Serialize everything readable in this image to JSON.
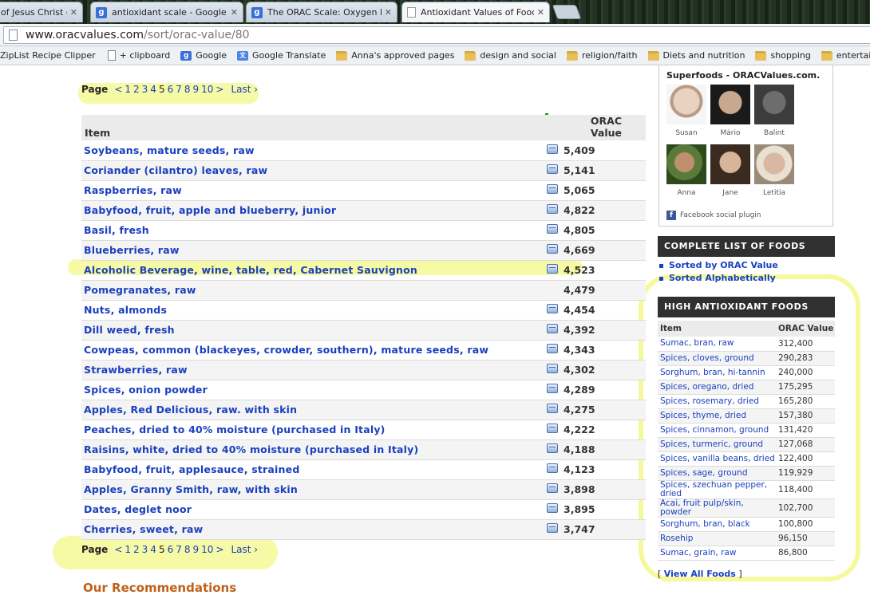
{
  "tabs": [
    {
      "label": "of Jesus Christ o",
      "icon": "page-icon"
    },
    {
      "label": "antioxidant scale - Google S",
      "icon": "google-icon"
    },
    {
      "label": "The ORAC Scale: Oxygen R",
      "icon": "google-icon"
    },
    {
      "label": "Antioxidant Values of Foods",
      "icon": "page-icon"
    }
  ],
  "tab_close": "✕",
  "address": {
    "host": "www.oracvalues.com",
    "path": "/sort/orac-value/80"
  },
  "bookmarks": [
    {
      "label": "ZipList Recipe Clipper",
      "icon": "none"
    },
    {
      "label": "+ clipboard",
      "icon": "page-icon"
    },
    {
      "label": "Google",
      "icon": "google-icon"
    },
    {
      "label": "Google Translate",
      "icon": "translate-icon"
    },
    {
      "label": "Anna's approved pages",
      "icon": "folder-icon"
    },
    {
      "label": "design and social",
      "icon": "folder-icon"
    },
    {
      "label": "religion/faith",
      "icon": "folder-icon"
    },
    {
      "label": "Diets and nutrition",
      "icon": "folder-icon"
    },
    {
      "label": "shopping",
      "icon": "folder-icon"
    },
    {
      "label": "entertainment",
      "icon": "folder-icon"
    }
  ],
  "pager": {
    "label": "Page",
    "prev": "<",
    "pages": [
      "1",
      "2",
      "3",
      "4",
      "5",
      "6",
      "7",
      "8",
      "9",
      "10"
    ],
    "current": "5",
    "next": ">",
    "last": "Last ›"
  },
  "table": {
    "col_item": "Item",
    "col_value": "ORAC Value",
    "rows": [
      {
        "name": "Soybeans, mature seeds, raw",
        "value": "5,409",
        "icon": true
      },
      {
        "name": "Coriander (cilantro) leaves, raw",
        "value": "5,141",
        "icon": true
      },
      {
        "name": "Raspberries, raw",
        "value": "5,065",
        "icon": true
      },
      {
        "name": "Babyfood, fruit, apple and blueberry, junior",
        "value": "4,822",
        "icon": true
      },
      {
        "name": "Basil, fresh",
        "value": "4,805",
        "icon": true
      },
      {
        "name": "Blueberries, raw",
        "value": "4,669",
        "icon": true
      },
      {
        "name": "Alcoholic Beverage, wine, table, red, Cabernet Sauvignon",
        "value": "4,523",
        "icon": true
      },
      {
        "name": "Pomegranates, raw",
        "value": "4,479",
        "icon": false
      },
      {
        "name": "Nuts, almonds",
        "value": "4,454",
        "icon": true
      },
      {
        "name": "Dill weed, fresh",
        "value": "4,392",
        "icon": true
      },
      {
        "name": "Cowpeas, common (blackeyes, crowder, southern), mature seeds, raw",
        "value": "4,343",
        "icon": true
      },
      {
        "name": "Strawberries, raw",
        "value": "4,302",
        "icon": true
      },
      {
        "name": "Spices, onion powder",
        "value": "4,289",
        "icon": true
      },
      {
        "name": "Apples, Red Delicious, raw. with skin",
        "value": "4,275",
        "icon": true
      },
      {
        "name": "Peaches, dried to 40% moisture (purchased in Italy)",
        "value": "4,222",
        "icon": true
      },
      {
        "name": "Raisins, white, dried to 40% moisture (purchased in Italy)",
        "value": "4,188",
        "icon": true
      },
      {
        "name": "Babyfood, fruit, applesauce, strained",
        "value": "4,123",
        "icon": true
      },
      {
        "name": "Apples, Granny Smith, raw, with skin",
        "value": "3,898",
        "icon": true
      },
      {
        "name": "Dates, deglet noor",
        "value": "3,895",
        "icon": true
      },
      {
        "name": "Cherries, sweet, raw",
        "value": "3,747",
        "icon": true
      }
    ]
  },
  "sidebar": {
    "fb_title": "Superfoods - ORACValues.com.",
    "fb_people": [
      "Susan",
      "Mário",
      "Balint",
      "Anna",
      "Jane",
      "Letitia"
    ],
    "fb_footer": "Facebook social plugin",
    "complete_title": "COMPLETE LIST OF FOODS",
    "complete_links": [
      "Sorted by ORAC Value",
      "Sorted Alphabetically"
    ],
    "high_title": "HIGH ANTIOXIDANT FOODS",
    "high_col_item": "Item",
    "high_col_value": "ORAC Value",
    "high_rows": [
      {
        "name": "Sumac, bran, raw",
        "value": "312,400"
      },
      {
        "name": "Spices, cloves, ground",
        "value": "290,283"
      },
      {
        "name": "Sorghum, bran, hi-tannin",
        "value": "240,000"
      },
      {
        "name": "Spices, oregano, dried",
        "value": "175,295"
      },
      {
        "name": "Spices, rosemary, dried",
        "value": "165,280"
      },
      {
        "name": "Spices, thyme, dried",
        "value": "157,380"
      },
      {
        "name": "Spices, cinnamon, ground",
        "value": "131,420"
      },
      {
        "name": "Spices, turmeric, ground",
        "value": "127,068"
      },
      {
        "name": "Spices, vanilla beans, dried",
        "value": "122,400"
      },
      {
        "name": "Spices, sage, ground",
        "value": "119,929"
      },
      {
        "name": "Spices, szechuan pepper, dried",
        "value": "118,400"
      },
      {
        "name": "Acai, fruit pulp/skin, powder",
        "value": "102,700"
      },
      {
        "name": "Sorghum, bran, black",
        "value": "100,800"
      },
      {
        "name": "Rosehip",
        "value": "96,150"
      },
      {
        "name": "Sumac, grain, raw",
        "value": "86,800"
      }
    ],
    "view_all": "View All Foods"
  },
  "bottom_heading": "Our Recommendations",
  "colors": {
    "link": "#1a3fbf",
    "highlight": "#eef55a",
    "sidebar_header": "#303030",
    "sort_arrow": "#1a9a1a"
  }
}
